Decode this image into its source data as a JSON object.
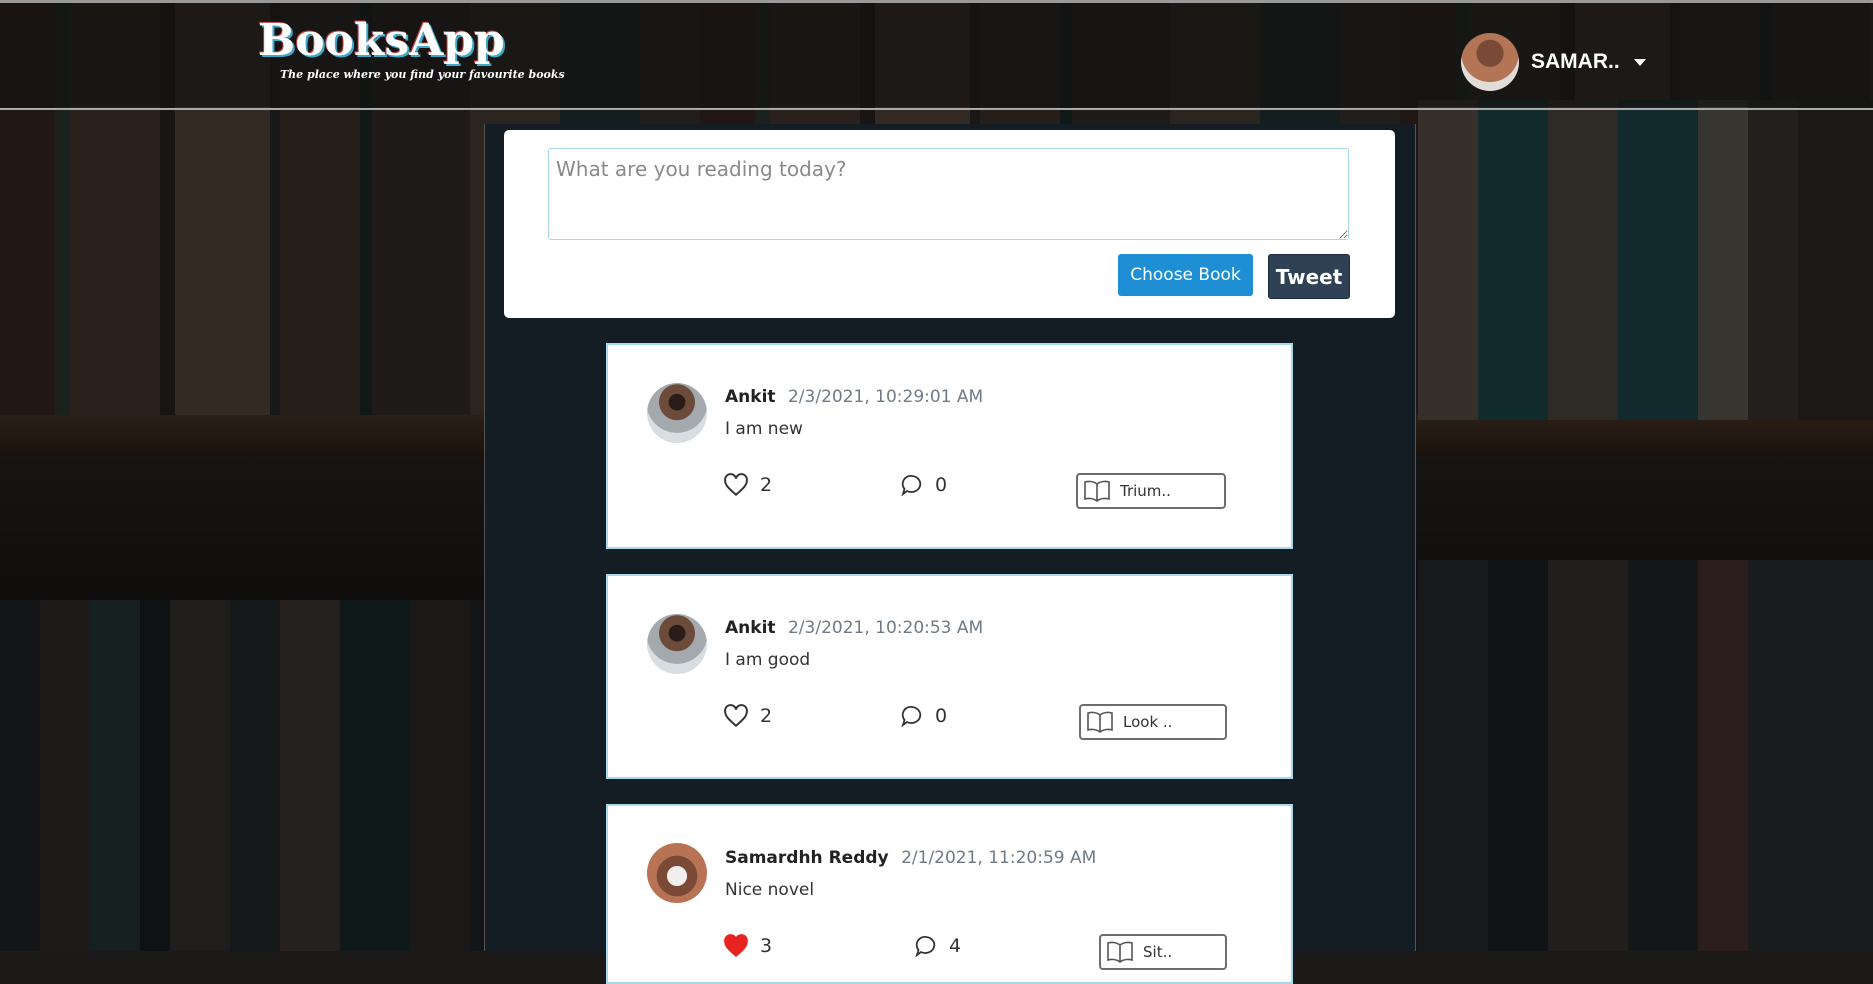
{
  "app": {
    "title": "BooksApp",
    "tagline": "The place where you find your favourite books"
  },
  "user": {
    "name": "SAMAR.."
  },
  "compose": {
    "placeholder": "What are you reading today?",
    "choose_book_label": "Choose Book",
    "tweet_label": "Tweet"
  },
  "tweets": [
    {
      "author": "Ankit",
      "time": "2/3/2021, 10:29:01 AM",
      "text": "I am new",
      "likes": "2",
      "comments": "0",
      "book": "Trium..",
      "liked": false
    },
    {
      "author": "Ankit",
      "time": "2/3/2021, 10:20:53 AM",
      "text": "I am good",
      "likes": "2",
      "comments": "0",
      "book": "Look ..",
      "liked": false
    },
    {
      "author": "Samardhh Reddy",
      "time": "2/1/2021, 11:20:59 AM",
      "text": "Nice novel",
      "likes": "3",
      "comments": "4",
      "book": "Sit..",
      "liked": true
    }
  ],
  "icons": {
    "like": "heart-icon",
    "liked": "heart-filled-icon",
    "comment": "comment-icon",
    "book": "book-icon",
    "caret": "caret-down-icon"
  },
  "colors": {
    "primary_button": "#1e8fd5",
    "tweet_button": "#2f4155",
    "liked_heart": "#e8231f",
    "card_border": "#a9d8ea",
    "timestamp": "#6f7a86"
  }
}
